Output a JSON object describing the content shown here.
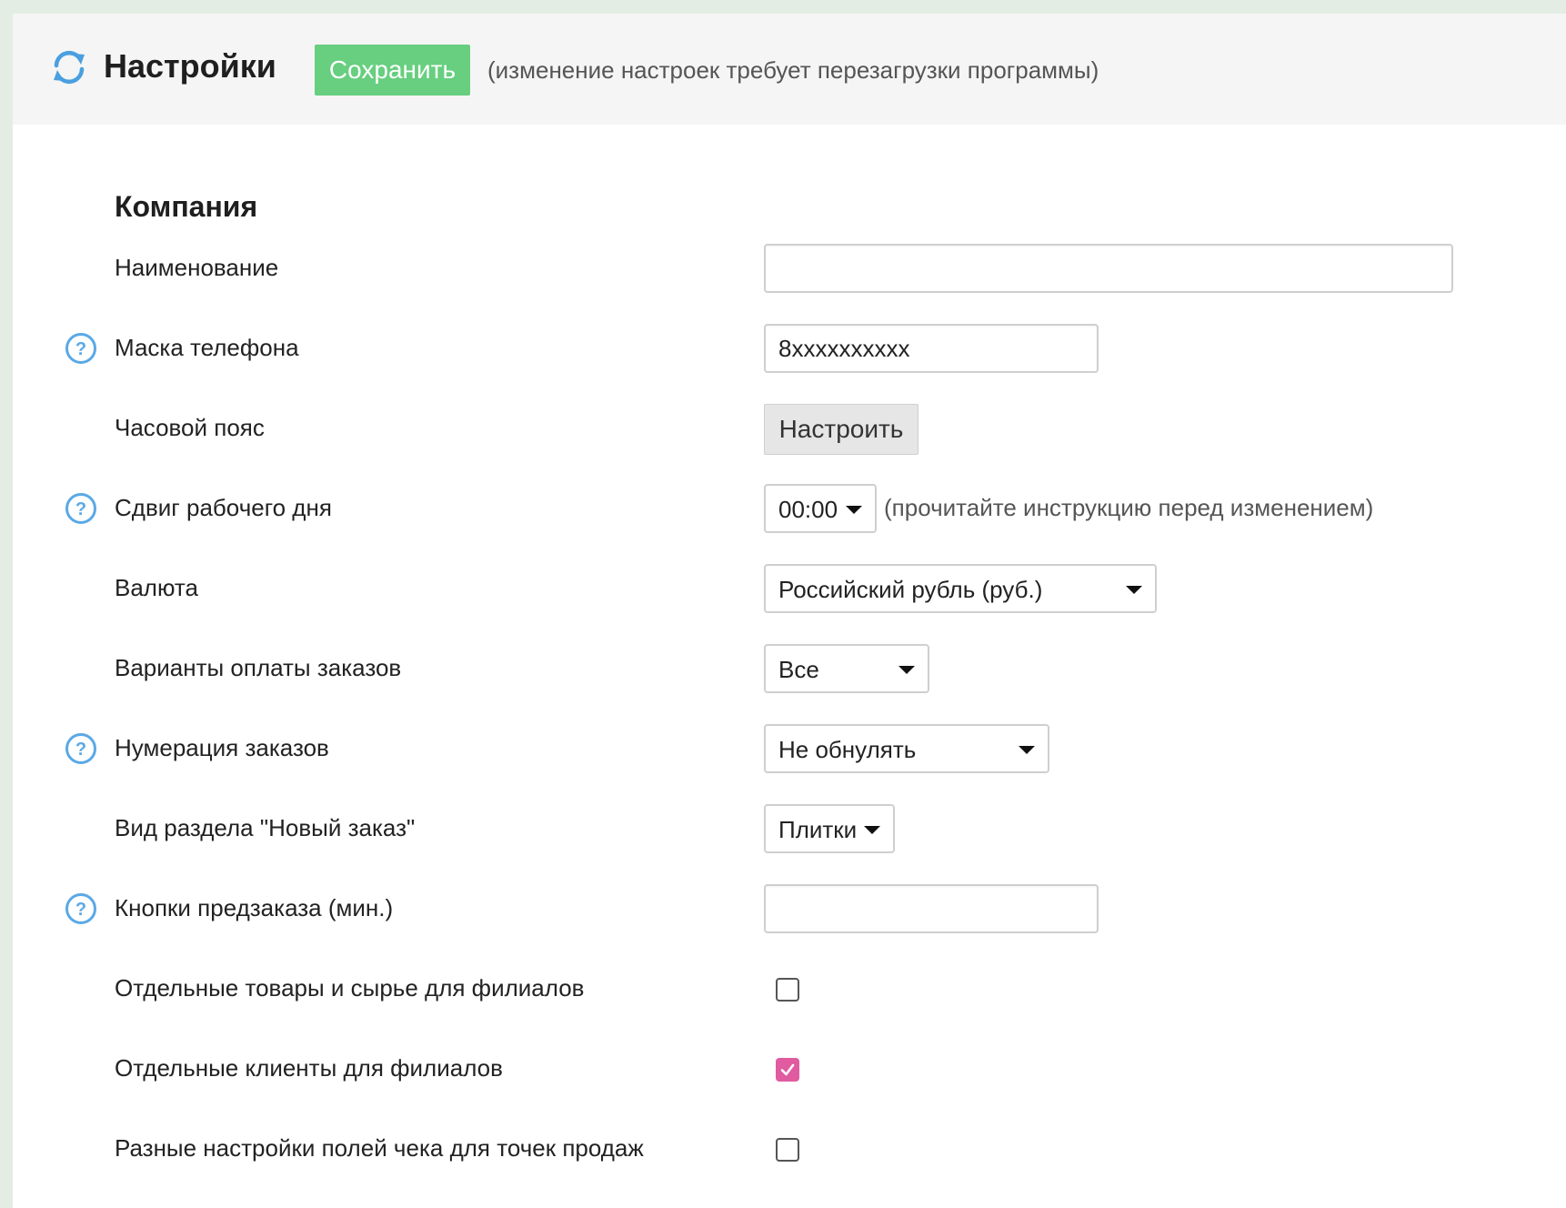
{
  "header": {
    "title": "Настройки",
    "save_label": "Сохранить",
    "restart_note": "(изменение настроек требует перезагрузки программы)"
  },
  "section": {
    "title": "Компания"
  },
  "fields": {
    "name": {
      "label": "Наименование",
      "value": ""
    },
    "phone_mask": {
      "label": "Маска телефона",
      "value": "8xxxxxxxxxx"
    },
    "timezone": {
      "label": "Часовой пояс",
      "button_label": "Настроить"
    },
    "workday_shift": {
      "label": "Сдвиг рабочего дня",
      "value": "00:00",
      "hint": "(прочитайте инструкцию перед изменением)"
    },
    "currency": {
      "label": "Валюта",
      "value": "Российский рубль (руб.)"
    },
    "payment_options": {
      "label": "Варианты оплаты заказов",
      "value": "Все"
    },
    "order_numbering": {
      "label": "Нумерация заказов",
      "value": "Не обнулять"
    },
    "new_order_view": {
      "label": "Вид раздела \"Новый заказ\"",
      "value": "Плитки"
    },
    "preorder_buttons": {
      "label": "Кнопки предзаказа (мин.)",
      "value": ""
    },
    "separate_goods": {
      "label": "Отдельные товары и сырье для филиалов",
      "checked": false
    },
    "separate_clients": {
      "label": "Отдельные клиенты для филиалов",
      "checked": true
    },
    "receipt_settings": {
      "label": "Разные настройки полей чека для точек продаж",
      "checked": false
    }
  },
  "colors": {
    "save_button": "#67cf7f",
    "help_icon": "#5aa9e6",
    "checkbox_checked": "#e05ba0",
    "refresh_icon": "#4a9fe0"
  },
  "icons": {
    "refresh": "refresh-icon",
    "help": "help-icon",
    "caret": "caret-icon",
    "check": "check-mark-icon"
  }
}
